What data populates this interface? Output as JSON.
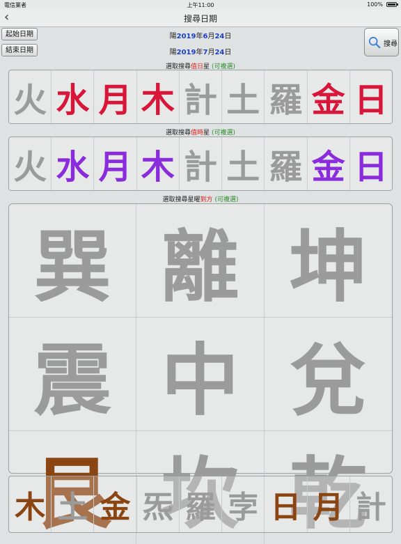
{
  "status_bar": {
    "carrier": "電信業者",
    "time": "上午11:00",
    "battery": "100%"
  },
  "nav": {
    "title": "搜尋日期",
    "back": "‹"
  },
  "start_button": "起始日期",
  "end_button": "結束日期",
  "start_date": {
    "prefix": "陽",
    "year": "2019",
    "y": "年",
    "month": "6",
    "m": "月",
    "day": "24",
    "d": "日"
  },
  "end_date": {
    "prefix": "陽",
    "year": "2019",
    "y": "年",
    "month": "7",
    "m": "月",
    "day": "24",
    "d": "日"
  },
  "search_button": "搜尋",
  "section1": {
    "pre": "選取搜尋",
    "hl": "值日",
    "post": "星",
    "note": "(可複選)"
  },
  "section2": {
    "pre": "選取搜尋",
    "hl": "值時",
    "post": "星",
    "note": "(可複選)"
  },
  "section3": {
    "pre": "選取搜尋星曜",
    "hl": "到方",
    "note": "(可複選)"
  },
  "day_stars": [
    {
      "char": "火",
      "state": "off",
      "color": "#9b9b9b"
    },
    {
      "char": "水",
      "state": "on",
      "color": "#d8163a"
    },
    {
      "char": "月",
      "state": "on",
      "color": "#d8163a"
    },
    {
      "char": "木",
      "state": "on",
      "color": "#d8163a"
    },
    {
      "char": "計",
      "state": "off",
      "color": "#9b9b9b"
    },
    {
      "char": "土",
      "state": "off",
      "color": "#9b9b9b"
    },
    {
      "char": "羅",
      "state": "off",
      "color": "#9b9b9b"
    },
    {
      "char": "金",
      "state": "on",
      "color": "#d8163a"
    },
    {
      "char": "日",
      "state": "on",
      "color": "#d8163a"
    }
  ],
  "hour_stars": [
    {
      "char": "火",
      "state": "off",
      "color": "#9b9b9b"
    },
    {
      "char": "水",
      "state": "on",
      "color": "#8a2bdc"
    },
    {
      "char": "月",
      "state": "on",
      "color": "#8a2bdc"
    },
    {
      "char": "木",
      "state": "on",
      "color": "#8a2bdc"
    },
    {
      "char": "計",
      "state": "off",
      "color": "#9b9b9b"
    },
    {
      "char": "土",
      "state": "off",
      "color": "#9b9b9b"
    },
    {
      "char": "羅",
      "state": "off",
      "color": "#9b9b9b"
    },
    {
      "char": "金",
      "state": "on",
      "color": "#8a2bdc"
    },
    {
      "char": "日",
      "state": "on",
      "color": "#8a2bdc"
    }
  ],
  "directions": [
    {
      "char": "巽",
      "state": "off",
      "color": "#9b9b9b"
    },
    {
      "char": "離",
      "state": "off",
      "color": "#9b9b9b"
    },
    {
      "char": "坤",
      "state": "off",
      "color": "#9b9b9b"
    },
    {
      "char": "震",
      "state": "off",
      "color": "#9b9b9b"
    },
    {
      "char": "中",
      "state": "off",
      "color": "#9b9b9b"
    },
    {
      "char": "兌",
      "state": "off",
      "color": "#9b9b9b"
    },
    {
      "char": "艮",
      "state": "on",
      "color": "#8a4513"
    },
    {
      "char": "坎",
      "state": "off",
      "color": "#9b9b9b"
    },
    {
      "char": "乾",
      "state": "off",
      "color": "#9b9b9b"
    }
  ],
  "direction_stars": [
    {
      "char": "木",
      "state": "on",
      "color": "#8a4513"
    },
    {
      "char": "土",
      "state": "off",
      "color": "#9b9b9b"
    },
    {
      "char": "金",
      "state": "on",
      "color": "#8a4513"
    },
    {
      "char": "炁",
      "state": "off",
      "color": "#9b9b9b"
    },
    {
      "char": "羅",
      "state": "off",
      "color": "#9b9b9b"
    },
    {
      "char": "孛",
      "state": "off",
      "color": "#9b9b9b"
    },
    {
      "char": "日",
      "state": "on",
      "color": "#8a4513"
    },
    {
      "char": "月",
      "state": "on",
      "color": "#8a4513"
    },
    {
      "char": "計",
      "state": "off",
      "color": "#9b9b9b"
    }
  ]
}
